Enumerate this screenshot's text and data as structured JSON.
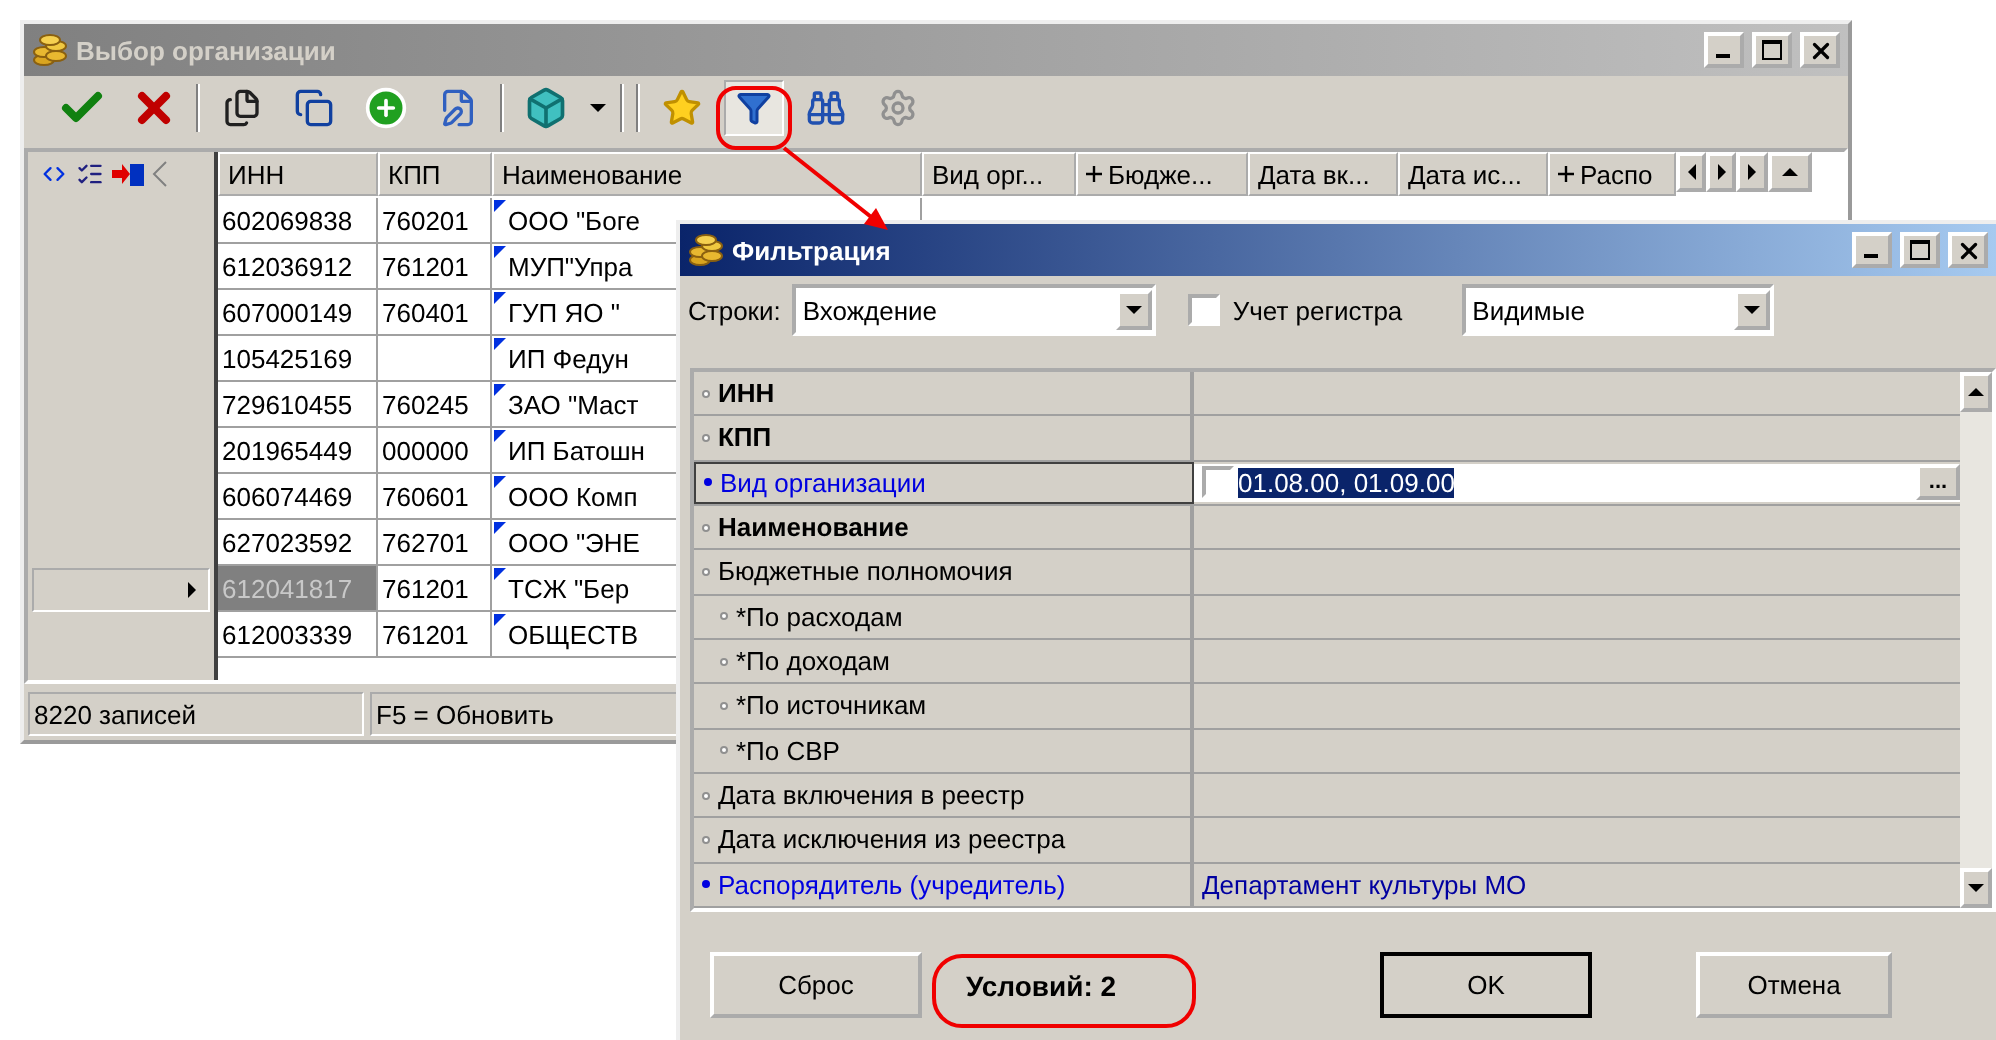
{
  "main_window": {
    "title": "Выбор организации",
    "toolbar": {
      "filter_active": true
    },
    "table": {
      "columns": [
        {
          "label": "ИНН",
          "kind": "plain"
        },
        {
          "label": "КПП",
          "kind": "plain"
        },
        {
          "label": "Наименование",
          "kind": "plain"
        },
        {
          "label": "Вид орг...",
          "kind": "plain"
        },
        {
          "label": "Бюдже...",
          "kind": "linked"
        },
        {
          "label": "Дата вк...",
          "kind": "plain"
        },
        {
          "label": "Дата ис...",
          "kind": "plain"
        },
        {
          "label": "Распо",
          "kind": "linked"
        }
      ],
      "rows": [
        {
          "inn": "602069838",
          "kpp": "760201",
          "name": "ООО \"Боге",
          "selected": false
        },
        {
          "inn": "612036912",
          "kpp": "761201",
          "name": "МУП\"Упра",
          "selected": false
        },
        {
          "inn": "607000149",
          "kpp": "760401",
          "name": "ГУП ЯО \"",
          "selected": false
        },
        {
          "inn": "105425169",
          "kpp": "",
          "name": "ИП Федун",
          "selected": false
        },
        {
          "inn": "729610455",
          "kpp": "760245",
          "name": "ЗАО \"Маст",
          "selected": false
        },
        {
          "inn": "201965449",
          "kpp": "000000",
          "name": "ИП Батошн",
          "selected": false
        },
        {
          "inn": "606074469",
          "kpp": "760601",
          "name": "ООО Комп",
          "selected": false
        },
        {
          "inn": "627023592",
          "kpp": "762701",
          "name": "ООО \"ЭНЕ",
          "selected": false
        },
        {
          "inn": "612041817",
          "kpp": "761201",
          "name": "ТСЖ \"Бер",
          "selected": true
        },
        {
          "inn": "612003339",
          "kpp": "761201",
          "name": "ОБЩЕСТВ",
          "selected": false
        }
      ]
    },
    "status_bar": [
      "8220 записей",
      "F5 = Обновить"
    ]
  },
  "filter_dialog": {
    "title": "Фильтрация",
    "rows_label": "Строки:",
    "match_mode": "Вхождение",
    "case_checkbox": {
      "label": "Учет регистра",
      "checked": false
    },
    "visibility": "Видимые",
    "properties": [
      {
        "label": "ИНН",
        "kind": "key"
      },
      {
        "label": "КПП",
        "kind": "key"
      },
      {
        "label": "Вид организации",
        "kind": "set",
        "value": "01.08.00, 01.09.00",
        "editing": true,
        "checked": false,
        "edit_button": "..."
      },
      {
        "label": "Наименование",
        "kind": "key"
      },
      {
        "label": "Бюджетные полномочия",
        "kind": "plain",
        "children": [
          {
            "label": "*По расходам"
          },
          {
            "label": "*По доходам"
          },
          {
            "label": "*По источникам"
          },
          {
            "label": "*По СВР"
          }
        ]
      },
      {
        "label": "Дата включения в реестр",
        "kind": "plain"
      },
      {
        "label": "Дата исключения из реестра",
        "kind": "plain"
      },
      {
        "label": "Распорядитель (учредитель)",
        "kind": "set",
        "value": "Департамент культуры МО"
      }
    ],
    "reset_button": "Сброс",
    "conditions": "Условий: 2",
    "buttons": [
      {
        "label": "OK",
        "default": true
      },
      {
        "label": "Отмена",
        "default": false
      }
    ]
  }
}
